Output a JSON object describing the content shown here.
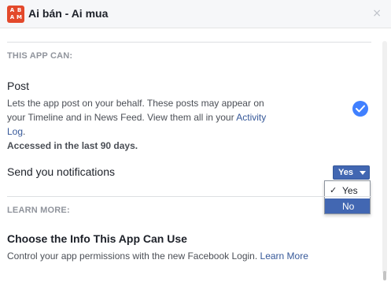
{
  "header": {
    "logo_letters": [
      "A",
      "B",
      "A",
      "M"
    ],
    "title": "Ai bán - Ai mua",
    "close_label": "×"
  },
  "sections": {
    "this_app_can": "THIS APP CAN:",
    "learn_more": "LEARN MORE:"
  },
  "post": {
    "title": "Post",
    "description": "Lets the app post on your behalf. These posts may appear on your Timeline and in News Feed. View them all in your ",
    "link": "Activity Log",
    "description_end": ".",
    "accessed": "Accessed in the last 90 days.",
    "checked": true
  },
  "notifications": {
    "title": "Send you notifications",
    "selected": "Yes",
    "options": [
      {
        "label": "Yes",
        "checked": true,
        "highlighted": false
      },
      {
        "label": "No",
        "checked": false,
        "highlighted": true
      }
    ],
    "check_mark": "✓"
  },
  "learn_more": {
    "title": "Choose the Info This App Can Use",
    "description": "Control your app permissions with the new Facebook Login. ",
    "link": "Learn More"
  },
  "colors": {
    "accent": "#4267b2",
    "link": "#365899",
    "check": "#4080ff",
    "logo": "#e3492b"
  }
}
